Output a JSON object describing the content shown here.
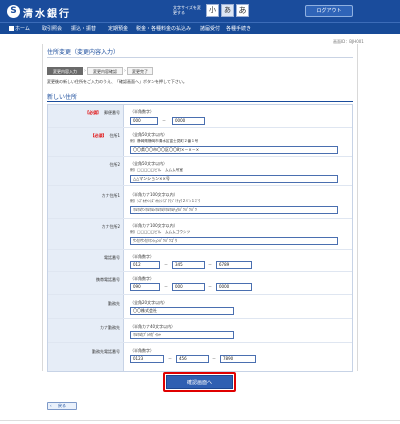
{
  "header": {
    "logo_mark": "S",
    "logo_text": "清水銀行",
    "font_size_label": "文字サイズを変更する",
    "font_sizes": [
      "小",
      "あ",
      "あ"
    ],
    "logout": "ログアウト"
  },
  "nav": {
    "items": [
      "ホーム",
      "取引照会",
      "振込・振替",
      "定期預金",
      "税金・各種料金の払込み",
      "諸届受付",
      "各種手続き"
    ]
  },
  "screen_id": "画面ID：BJH001",
  "page_title": "住所変更（変更内容入力）",
  "steps": [
    "変更内容入力",
    "変更内容確認",
    "変更完了"
  ],
  "instructions": "変更後の新しい住所をご入力のうえ、「確認画面へ」ボタンを押して下さい。",
  "section_title": "新しい住所",
  "required_label": "【必須】",
  "fields": {
    "postal": {
      "label": "郵便番号",
      "hint": "（半角数字）",
      "values": [
        "000",
        "0000"
      ]
    },
    "addr1": {
      "label": "住所1",
      "hint": "（全角50文字以内）",
      "example": "例）静岡県静岡市清水区富士見町２番１号",
      "value": "〇〇県〇〇市〇〇区〇〇町×－×－×"
    },
    "addr2": {
      "label": "住所2",
      "hint": "（全角50文字以内）",
      "example": "例）□□□□□ビル　ムムム号室",
      "value": "△△マンション××号"
    },
    "kana1": {
      "label": "カナ住所1",
      "hint": "（半角カナ100文字以内）",
      "example": "例）ｼｽﾞｵｶｹﾝｼｽﾞｵｶｼｼﾐｽﾞｸﾌｼﾞﾐﾁｮｳ２ﾊﾞﾝ１ｺﾞｳ",
      "value": "ﾏﾙﾏﾙｹﾝﾏﾙﾏﾙｼﾏﾙﾏﾙｸﾏﾙﾏﾙﾁｮｳﾊﾞﾂﾊﾞﾂﾊﾞﾂ"
    },
    "kana2": {
      "label": "カナ住所2",
      "hint": "（半角カナ100文字以内）",
      "example": "例）□□□□□ビル　ムムムゴウシツ",
      "value": "ｻﾝｶｸｻﾝｶｸﾏﾝｼｮﾝﾊﾞﾂﾊﾞﾂｺﾞｳ"
    },
    "phone": {
      "label": "電話番号",
      "hint": "（半角数字）",
      "values": [
        "012",
        "345",
        "6789"
      ]
    },
    "mobile": {
      "label": "携帯電話番号",
      "hint": "（半角数字）",
      "values": [
        "090",
        "000",
        "0000"
      ]
    },
    "work": {
      "label": "勤務先",
      "hint": "（全角20文字以内）",
      "value": "〇〇株式会社"
    },
    "work_kana": {
      "label": "カナ勤務先",
      "hint": "（半角カナ40文字以内）",
      "value": "ﾏﾙﾏﾙｶﾌﾞｼｷｶﾞｲｼｬ"
    },
    "work_phone": {
      "label": "勤務先電話番号",
      "hint": "（半角数字）",
      "values": [
        "0123",
        "456",
        "7890"
      ]
    }
  },
  "dash": "－",
  "confirm_button": "確認画面へ",
  "back_button": "戻る"
}
